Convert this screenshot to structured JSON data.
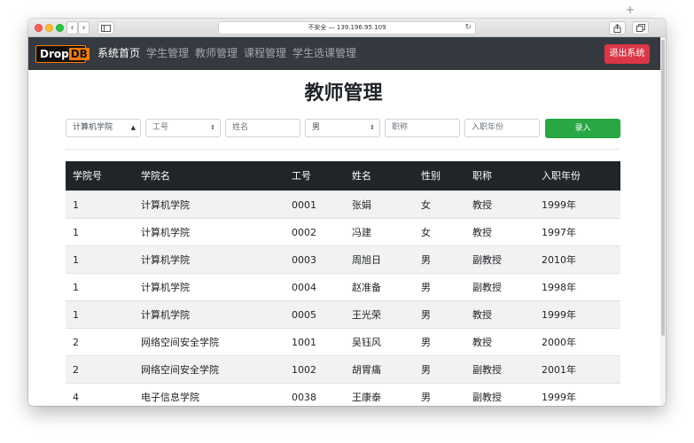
{
  "browser": {
    "url": "不安全 — 139.196.95.109",
    "back": "‹",
    "forward": "›",
    "newtab": "+"
  },
  "navbar": {
    "logo_main": "Drop",
    "logo_accent": "DB",
    "links": [
      "系统首页",
      "学生管理",
      "教师管理",
      "课程管理",
      "学生选课管理"
    ],
    "logout": "退出系统"
  },
  "page": {
    "title": "教师管理"
  },
  "form": {
    "college_select": "计算机学院",
    "id_placeholder": "工号",
    "name_placeholder": "姓名",
    "gender_select": "男",
    "title_placeholder": "职称",
    "year_placeholder": "入职年份",
    "submit": "录入"
  },
  "table": {
    "headers": [
      "学院号",
      "学院名",
      "工号",
      "姓名",
      "性别",
      "职称",
      "入职年份"
    ],
    "rows": [
      [
        "1",
        "计算机学院",
        "0001",
        "张娟",
        "女",
        "教授",
        "1999年"
      ],
      [
        "1",
        "计算机学院",
        "0002",
        "冯建",
        "女",
        "教授",
        "1997年"
      ],
      [
        "1",
        "计算机学院",
        "0003",
        "周旭日",
        "男",
        "副教授",
        "2010年"
      ],
      [
        "1",
        "计算机学院",
        "0004",
        "赵准备",
        "男",
        "副教授",
        "1998年"
      ],
      [
        "1",
        "计算机学院",
        "0005",
        "王光荣",
        "男",
        "教授",
        "1999年"
      ],
      [
        "2",
        "网络空间安全学院",
        "1001",
        "吴钰风",
        "男",
        "教授",
        "2000年"
      ],
      [
        "2",
        "网络空间安全学院",
        "1002",
        "胡胃痛",
        "男",
        "副教授",
        "2001年"
      ],
      [
        "4",
        "电子信息学院",
        "0038",
        "王康泰",
        "男",
        "副教授",
        "1999年"
      ]
    ]
  },
  "colors": {
    "navbar": "#343a40",
    "logout": "#dc3545",
    "submit": "#28a745",
    "table_header": "#212529"
  }
}
